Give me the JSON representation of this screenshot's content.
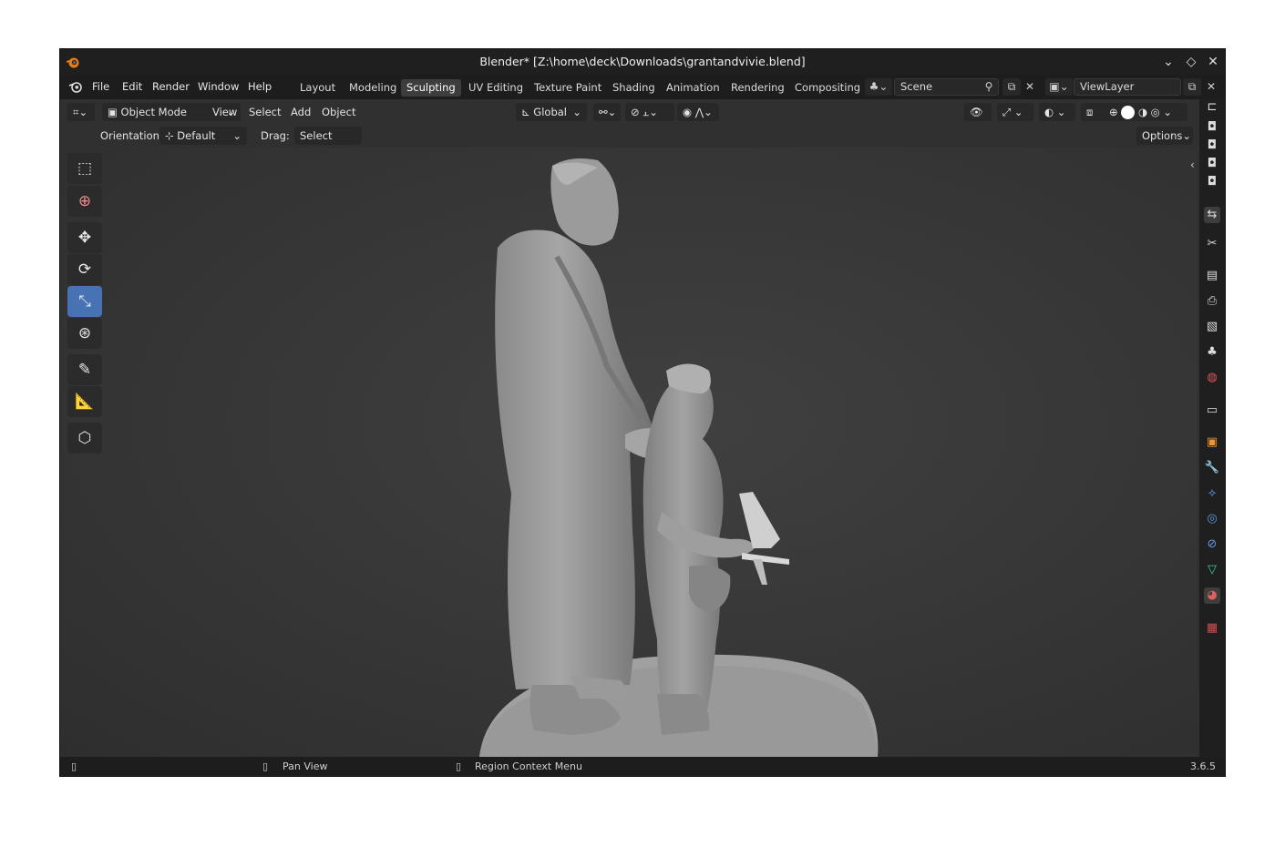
{
  "window": {
    "title": "Blender* [Z:\\home\\deck\\Downloads\\grantandvivie.blend]",
    "controls": [
      "⌄",
      "◇",
      "✕"
    ]
  },
  "menu": [
    "File",
    "Edit",
    "Render",
    "Window",
    "Help"
  ],
  "workspaces": [
    "Layout",
    "Modeling",
    "Sculpting",
    "UV Editing",
    "Texture Paint",
    "Shading",
    "Animation",
    "Rendering",
    "Compositing"
  ],
  "active_workspace": "Sculpting",
  "scene": {
    "value": "Scene"
  },
  "viewlayer": {
    "value": "ViewLayer"
  },
  "header": {
    "mode": "Object Mode",
    "view": "View",
    "select": "Select",
    "add": "Add",
    "object": "Object",
    "transform": "Global"
  },
  "subheader": {
    "orientation_label": "Orientation:",
    "orientation_value": "Default",
    "drag_label": "Drag:",
    "drag_value": "Select Box",
    "options": "Options"
  },
  "tools": [
    "select-box",
    "cursor",
    "move",
    "rotate",
    "scale",
    "transform",
    "annotate",
    "measure",
    "add-cube"
  ],
  "active_tool": "scale",
  "status": {
    "pan": "Pan View",
    "context": "Region Context Menu",
    "version": "3.6.5"
  },
  "colors": {
    "accent": "#4772b3",
    "background": "#303030"
  }
}
